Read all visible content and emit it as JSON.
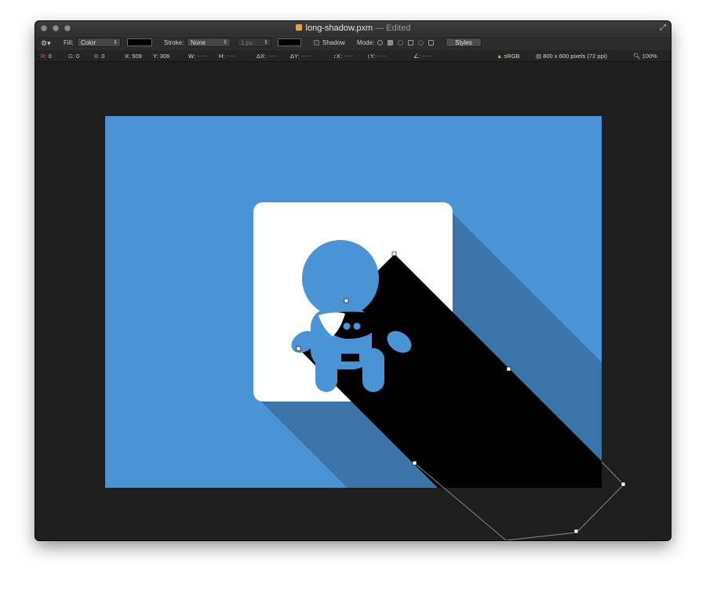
{
  "window": {
    "title": "long-shadow.pxm",
    "edited_suffix": "— Edited"
  },
  "toolbar": {
    "fill_label": "Fill:",
    "fill_value": "Color",
    "stroke_label": "Stroke:",
    "stroke_value": "None",
    "stroke_width": "1 px",
    "shadow_label": "Shadow",
    "mode_label": "Mode:",
    "styles_button": "Styles"
  },
  "infobar": {
    "r_label": "R:",
    "r_value": "0",
    "g_label": "G:",
    "g_value": "0",
    "b_label": "B:",
    "b_value": "0",
    "x_label": "X:",
    "x_value": "509",
    "y_label": "Y:",
    "y_value": "306",
    "w_label": "W:",
    "w_value": "-----",
    "h_label": "H:",
    "h_value": "-----",
    "dx_label": "ΔX:",
    "dx_value": "-----",
    "dy_label": "ΔY:",
    "dy_value": "-----",
    "ax_label": "↕X:",
    "ax_value": "-----",
    "ay_label": "↕Y:",
    "ay_value": "-----",
    "angle_label": "∠:",
    "angle_value": "-----",
    "color_profile": "sRGB",
    "document_size": "800 x 600 pixels (72 ppi)",
    "zoom": "100%"
  },
  "colors": {
    "canvas_bg": "#4a93d5",
    "long_shadow": "#3a74a8",
    "selected_shape": "#000000",
    "card": "#ffffff",
    "mascot": "#4a93d5"
  }
}
